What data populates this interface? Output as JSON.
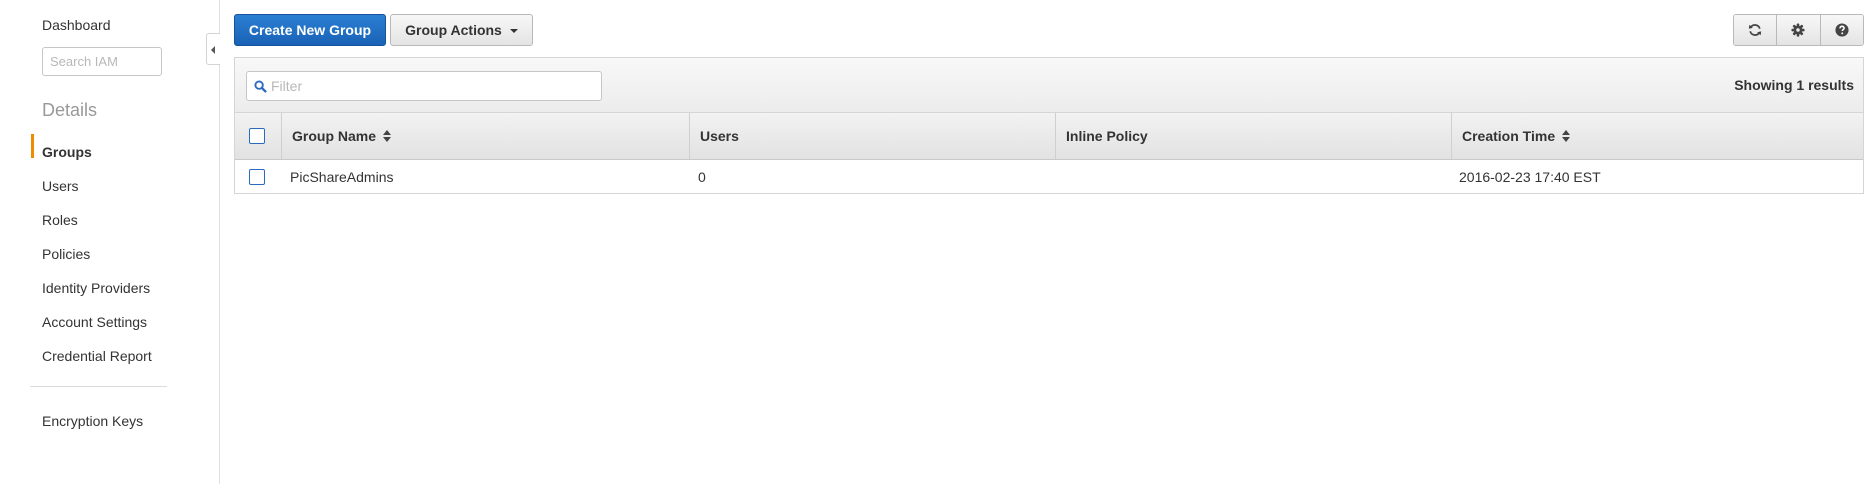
{
  "sidebar": {
    "dashboard": "Dashboard",
    "search_placeholder": "Search IAM",
    "section_title": "Details",
    "items": [
      {
        "label": "Groups",
        "active": true
      },
      {
        "label": "Users"
      },
      {
        "label": "Roles"
      },
      {
        "label": "Policies"
      },
      {
        "label": "Identity Providers"
      },
      {
        "label": "Account Settings"
      },
      {
        "label": "Credential Report"
      }
    ],
    "extra_item": "Encryption Keys",
    "accent_color": "#f08b00"
  },
  "toolbar": {
    "create_label": "Create New Group",
    "actions_label": "Group Actions",
    "icons": [
      "refresh-icon",
      "gear-icon",
      "help-icon"
    ]
  },
  "table": {
    "filter_placeholder": "Filter",
    "showing": "Showing 1 results",
    "columns": [
      "Group Name",
      "Users",
      "Inline Policy",
      "Creation Time"
    ],
    "rows": [
      {
        "group_name": "PicShareAdmins",
        "users": "0",
        "inline_policy": "",
        "creation_time": "2016-02-23 17:40 EST"
      }
    ]
  },
  "colors": {
    "primary_button": "#1a62b5",
    "checkbox_border": "#2b6bbd"
  }
}
